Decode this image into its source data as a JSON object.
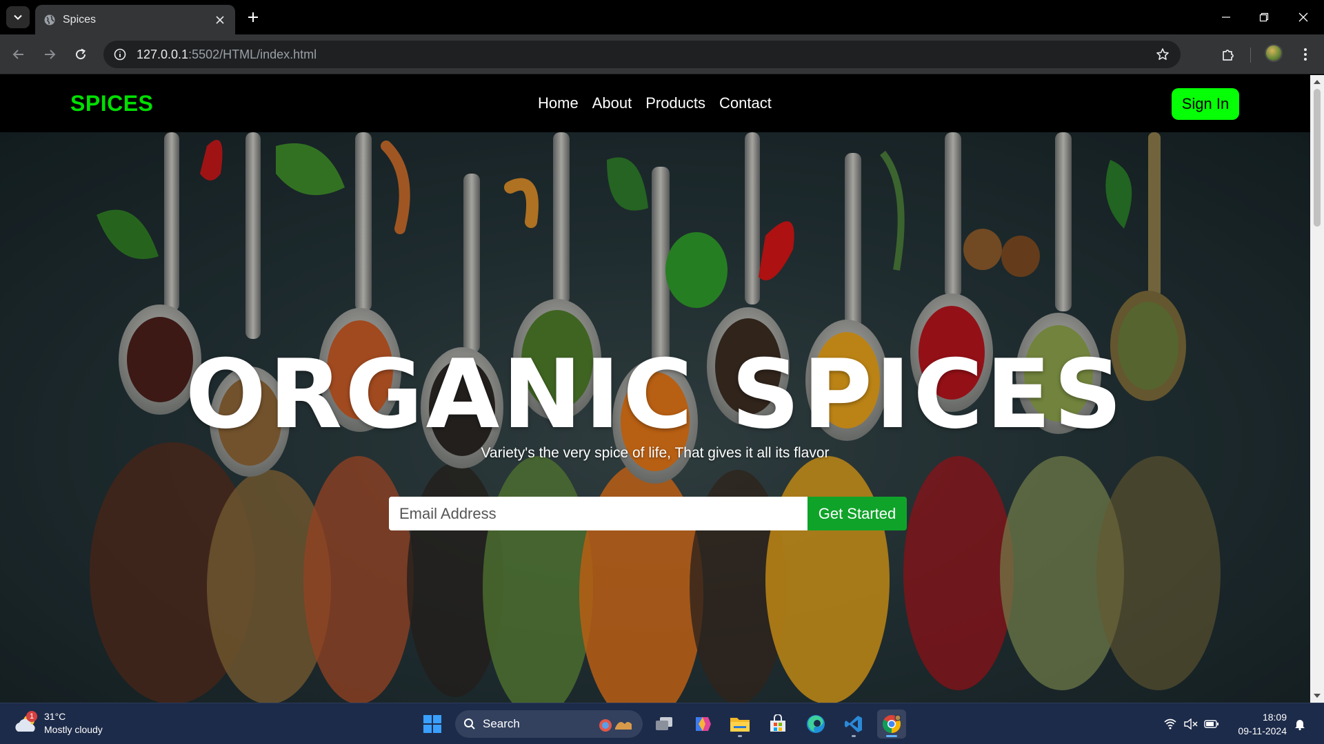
{
  "browser": {
    "tab_title": "Spices",
    "url_host": "127.0.0.1",
    "url_rest": ":5502/HTML/index.html"
  },
  "site": {
    "brand": "SPICES",
    "nav": [
      "Home",
      "About",
      "Products",
      "Contact"
    ],
    "signin_label": "Sign In",
    "brand_color": "#00e000",
    "accent_button": "#06ff06"
  },
  "hero": {
    "title": "ORGANIC SPICES",
    "subtitle": "Variety's the very spice of life, That gives it all its flavor",
    "email_placeholder": "Email Address",
    "cta_label": "Get Started",
    "cta_color": "#10a32a"
  },
  "taskbar": {
    "weather_badge": "1",
    "temperature": "31°C",
    "condition": "Mostly cloudy",
    "search_label": "Search",
    "time": "18:09",
    "date": "09-11-2024",
    "apps": [
      "start-icon",
      "task-view-icon",
      "copilot-icon",
      "file-explorer-icon",
      "microsoft-store-icon",
      "edge-icon",
      "vscode-icon",
      "chrome-icon"
    ]
  }
}
